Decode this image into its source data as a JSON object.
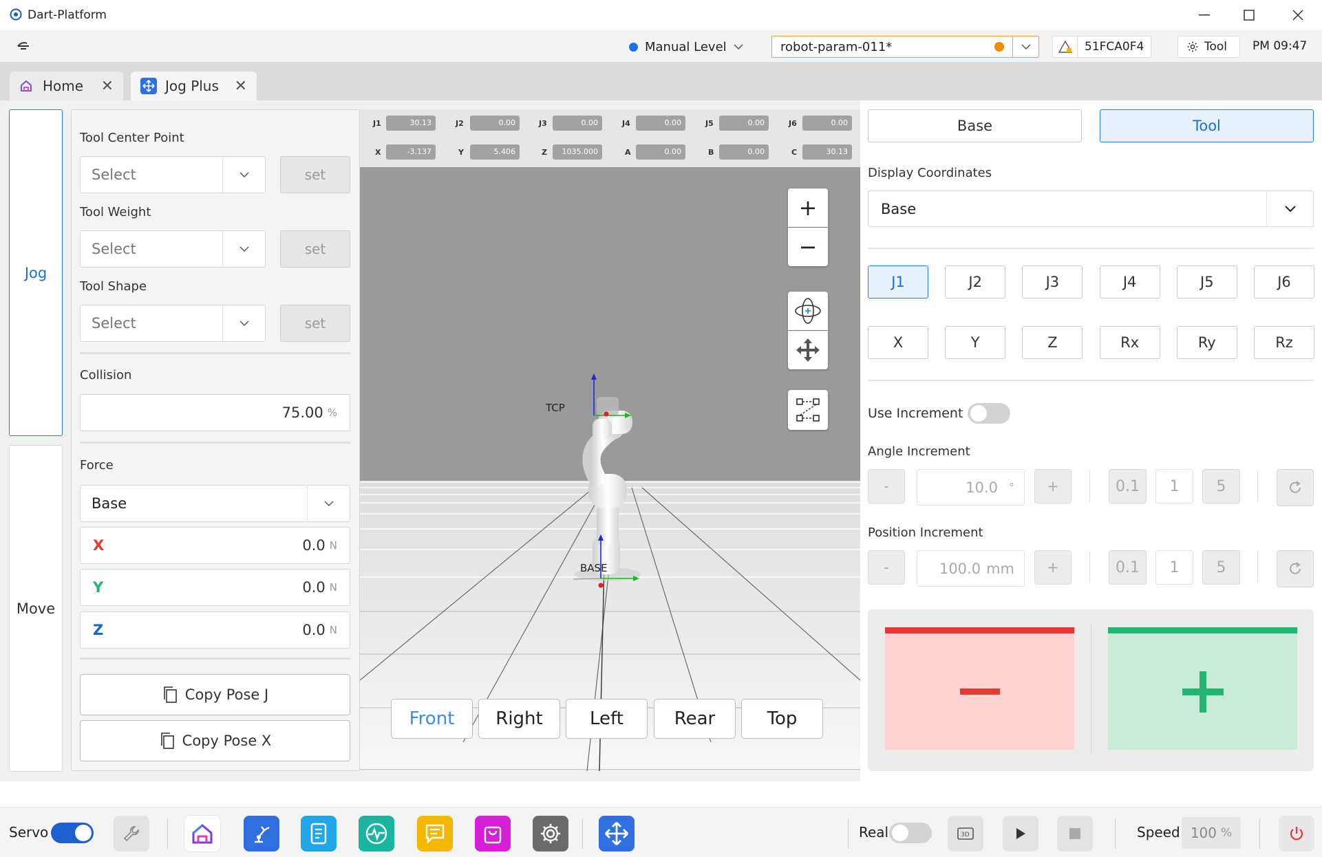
{
  "window": {
    "title": "Dart-Platform",
    "minimize": "—",
    "maximize": "☐",
    "close": "✕"
  },
  "appbar": {
    "level": "Manual Level",
    "level_color": "#1a73e8",
    "param": "robot-param-011*",
    "param_dot_color": "#f08c00",
    "serial": "51FCA0F4",
    "tool_label": "Tool",
    "time": "PM 09:47"
  },
  "tabs": [
    {
      "label": "Home",
      "close": "✕"
    },
    {
      "label": "Jog Plus",
      "close": "✕"
    }
  ],
  "sidemenu": {
    "jog": "Jog",
    "move": "Move"
  },
  "tool_panel": {
    "tcp_label": "Tool Center Point",
    "tcp_value": "Select",
    "weight_label": "Tool Weight",
    "weight_value": "Select",
    "shape_label": "Tool Shape",
    "shape_value": "Select",
    "set_label": "set",
    "collision_label": "Collision",
    "collision_value": "75.00",
    "collision_unit": "%",
    "force_label": "Force",
    "force_frame": "Base",
    "force": [
      {
        "axis": "X",
        "value": "0.0",
        "unit": "N",
        "color": "#e53935"
      },
      {
        "axis": "Y",
        "value": "0.0",
        "unit": "N",
        "color": "#22b573"
      },
      {
        "axis": "Z",
        "value": "0.0",
        "unit": "N",
        "color": "#1e63c8"
      }
    ],
    "copy_j": "Copy Pose J",
    "copy_x": "Copy Pose X"
  },
  "viewport": {
    "joints": [
      {
        "key": "J1",
        "value": "30.13"
      },
      {
        "key": "J2",
        "value": "0.00"
      },
      {
        "key": "J3",
        "value": "0.00"
      },
      {
        "key": "J4",
        "value": "0.00"
      },
      {
        "key": "J5",
        "value": "0.00"
      },
      {
        "key": "J6",
        "value": "0.00"
      }
    ],
    "pose": [
      {
        "key": "X",
        "value": "-3.137"
      },
      {
        "key": "Y",
        "value": "5.406"
      },
      {
        "key": "Z",
        "value": "1035.000"
      },
      {
        "key": "A",
        "value": "0.00"
      },
      {
        "key": "B",
        "value": "0.00"
      },
      {
        "key": "C",
        "value": "30.13"
      }
    ],
    "tcp_label": "TCP",
    "base_label": "BASE",
    "zoom_in": "+",
    "zoom_out": "−",
    "views": [
      "Front",
      "Right",
      "Left",
      "Rear",
      "Top"
    ],
    "active_view": "Front"
  },
  "jog_panel": {
    "frame_base": "Base",
    "frame_tool": "Tool",
    "display_coords_label": "Display Coordinates",
    "display_coords_value": "Base",
    "joint_buttons": [
      "J1",
      "J2",
      "J3",
      "J4",
      "J5",
      "J6"
    ],
    "axis_buttons": [
      "X",
      "Y",
      "Z",
      "Rx",
      "Ry",
      "Rz"
    ],
    "use_increment_label": "Use Increment",
    "angle_label": "Angle Increment",
    "angle_value": "10.0",
    "angle_unit": "°",
    "position_label": "Position Increment",
    "position_value": "100.0",
    "position_unit": "mm",
    "minus": "-",
    "plus": "+",
    "steps": [
      "0.1",
      "1",
      "5"
    ],
    "jog_minus_color": "#e53935",
    "jog_plus_color": "#22b573"
  },
  "bottombar": {
    "servo_label": "Servo",
    "real_label": "Real",
    "speed_label": "Speed",
    "speed_value": "100",
    "speed_unit": "%",
    "apps": [
      "home-app-icon",
      "robot-app-icon",
      "document-app-icon",
      "monitor-app-icon",
      "chat-app-icon",
      "store-app-icon",
      "settings-app-icon",
      "jog-app-icon"
    ]
  }
}
